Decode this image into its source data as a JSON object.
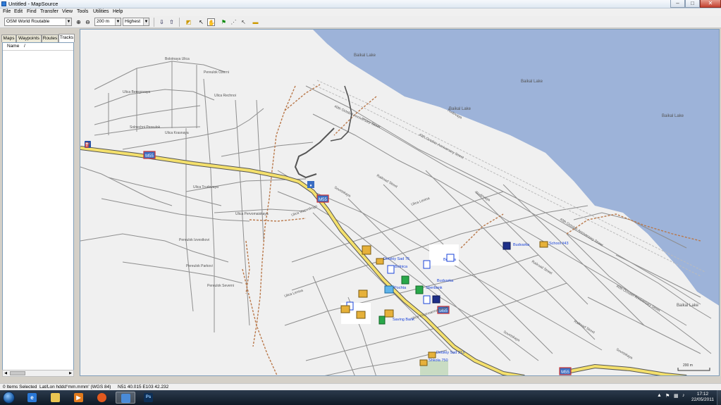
{
  "window": {
    "title": "Untitled - MapSource",
    "minimize": "–",
    "maximize": "□",
    "close": "✕"
  },
  "menu": [
    "File",
    "Edit",
    "Find",
    "Transfer",
    "View",
    "Tools",
    "Utilities",
    "Help"
  ],
  "toolbar": {
    "map_product": "OSM World Routable",
    "zoom_level": "200 m",
    "detail_level": "Highest",
    "icons": [
      "zoom-in-icon",
      "zoom-out-icon",
      "receive-from-device-icon",
      "send-to-device-icon",
      "zoom-tool-icon",
      "selection-tool-icon",
      "hand-tool-icon",
      "waypoint-tool-icon",
      "route-tool-icon",
      "track-tool-icon",
      "distance-tool-icon"
    ]
  },
  "sidebar": {
    "tabs": [
      "Maps",
      "Waypoints",
      "Routes",
      "Tracks"
    ],
    "active_tab": "Tracks",
    "columns": [
      "Name",
      "/"
    ]
  },
  "status": {
    "selection": "0 Items Selected",
    "format": "Lat/Lon hddd°mm.mmm' (WGS 84)",
    "position": "N51 40.015 E103 42.232"
  },
  "taskbar": {
    "time": "17:12",
    "date": "22/05/2011"
  },
  "map": {
    "water_color": "#9db3d9",
    "land_color": "#f0f0f0",
    "labels": {
      "lake1": "Baikal Lake",
      "lake2": "Baikal Lake",
      "lake3": "Baikal Lake",
      "lake4": "Baikal Lake",
      "lake5": "Baikal Lake",
      "oct1": "40th October Anniversary Street",
      "oct2": "40th October Anniversary Street",
      "oct3": "40th October Anniversary Street",
      "oct4": "40th October Anniversary Street",
      "railroad1": "Railroad Street",
      "railroad2": "Railroad Street",
      "railroad3": "Railroad Street",
      "trudovaya1": "Trudovaya",
      "trudovaya2": "Trudovaya",
      "sovetskaya1": "Sovetskaya",
      "sovetskaya2": "Sovetskaya",
      "sovetskaya3": "Sovetskaya",
      "lenina1": "Ulica Lenina",
      "lenina2": "Ulica Lenina",
      "bolotnaya": "Bolotnaya Ulica",
      "ozerni": "Pereulok Ozerni",
      "beregovaya": "Ulica Beregovaya",
      "rechnoi": "Ulica Rechnoi",
      "ozernaya": "Ulica Ozernaya",
      "solnechni": "Solnechni Pereulok",
      "krasnaya": "Ulica Krasnaya",
      "kolkhoznaya": "Ulica Kolkhoznaya",
      "tsentralnaya": "Ulica Tsentralnaya",
      "trudovaya_ul": "Ulica Trudovaya",
      "kamenka": "Pereulok Kamenka",
      "vorovskogo": "Ulica Vorovskogo",
      "pervomaiskaya": "Ulica Pervomaiskaya",
      "krasnoarmeiskaya": "Ulica Krasnoarmeiskaya",
      "izvestkovi": "Pereulok Izvestkovi",
      "parkovi": "Pereulok Parkovi",
      "severni": "Pereulok Severni",
      "pochta": "Pochta",
      "sberbank": "Sberbank",
      "sberbank2": "Saving Bank",
      "ds76": "Detskiy Sad 76",
      "school": "School #43",
      "ds213": "Detskiy Sad 213",
      "shkola": "Shkola 750",
      "bolnitsa": "Bolnica",
      "budvarka": "Budvarka",
      "budvarka2": "Budvarka",
      "m55": "M55",
      "scale": "200 m"
    }
  }
}
